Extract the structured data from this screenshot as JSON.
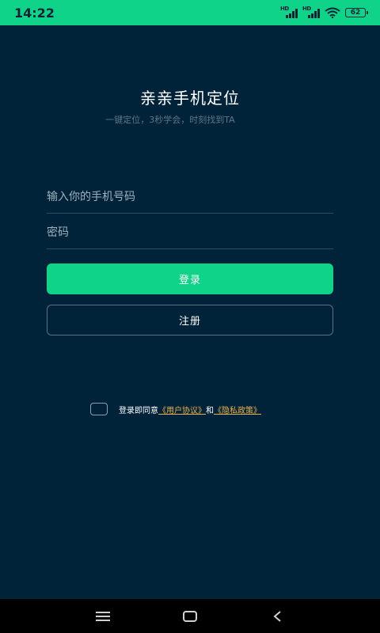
{
  "status_bar": {
    "time": "14:22",
    "signal_labels": [
      "HD",
      "HD"
    ],
    "battery": "62",
    "background_color": "#0ed389",
    "icons": [
      "signal-icon",
      "signal-icon",
      "wifi-icon",
      "battery-icon"
    ]
  },
  "header": {
    "title": "亲亲手机定位",
    "subtitle": "一键定位，3秒学会，时刻找到TA"
  },
  "form": {
    "phone_placeholder": "输入你的手机号码",
    "phone_value": "",
    "password_placeholder": "密码",
    "password_value": "",
    "login_label": "登录",
    "register_label": "注册"
  },
  "agreement": {
    "prefix": "登录即同意",
    "user_agreement": "《用户协议》",
    "conjunction": "和",
    "privacy_policy": "《隐私政策》",
    "checked": false
  },
  "colors": {
    "background": "#00233a",
    "accent": "#0ed389",
    "link": "#e8b24a"
  },
  "nav_bar": {
    "icons": [
      "menu-icon",
      "home-icon",
      "back-icon"
    ]
  }
}
